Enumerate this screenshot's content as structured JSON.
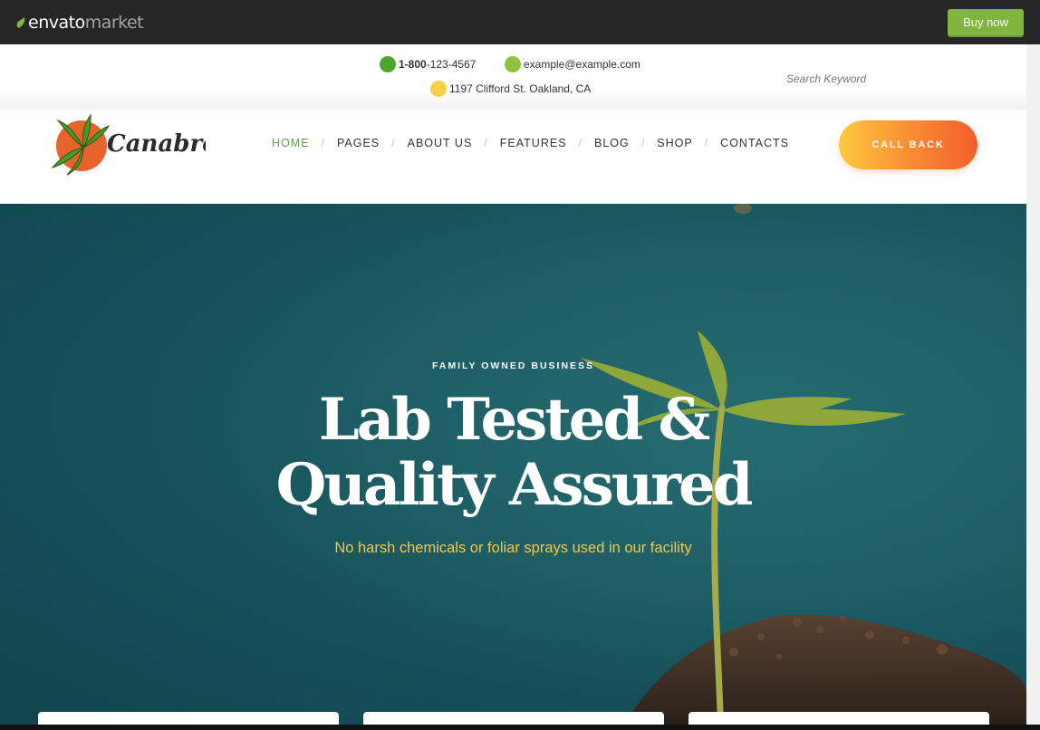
{
  "envato": {
    "brand": "envato",
    "brand_suffix": "market",
    "buy_label": "Buy now"
  },
  "contact": {
    "phone_bold": "1-800",
    "phone_rest": "-123-4567",
    "email": "example@example.com",
    "address": "1197 Clifford St. Oakland, CA",
    "search_placeholder": "Search Keyword"
  },
  "header": {
    "logo_text": "Canabro",
    "nav": [
      {
        "label": "HOME"
      },
      {
        "label": "PAGES"
      },
      {
        "label": "ABOUT US"
      },
      {
        "label": "FEATURES"
      },
      {
        "label": "BLOG"
      },
      {
        "label": "SHOP"
      },
      {
        "label": "CONTACTS"
      }
    ],
    "callback_label": "CALL BACK"
  },
  "hero": {
    "eyebrow": "FAMILY OWNED BUSINESS",
    "title_line1": "Lab Tested &",
    "title_line2": "Quality Assured",
    "subtitle": "No harsh chemicals or foliar sprays used in our facility"
  },
  "colors": {
    "brand_green": "#82b440",
    "nav_active": "#5fa13a",
    "hero_bg": "#1b5a62",
    "subtitle_yellow": "#f7c744",
    "callback_start": "#fdc93e",
    "callback_end": "#f45e2c"
  },
  "icons": {
    "phone": "green-dot-icon",
    "email": "lime-dot-icon",
    "address": "yellow-dot-icon"
  }
}
